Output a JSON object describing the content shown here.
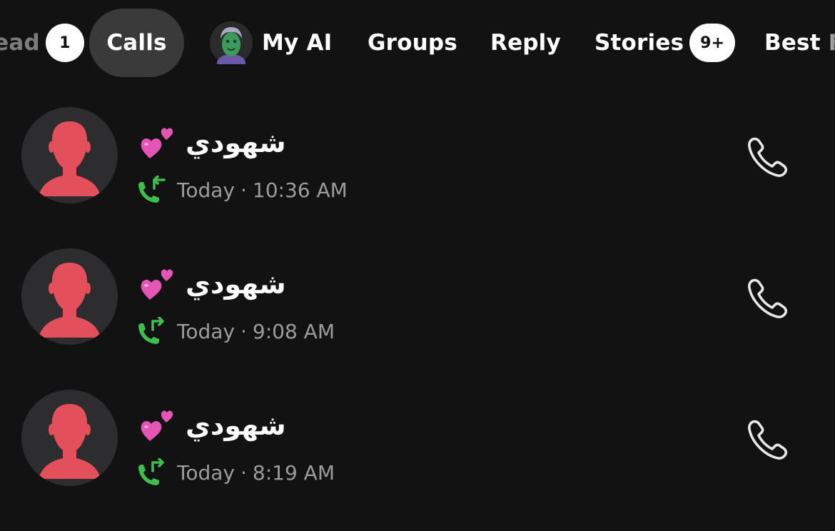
{
  "tabs": {
    "unread": {
      "label": "Unread",
      "badge": "1"
    },
    "calls": {
      "label": "Calls"
    },
    "myai": {
      "label": "My AI"
    },
    "groups": {
      "label": "Groups"
    },
    "reply": {
      "label": "Reply"
    },
    "stories": {
      "label": "Stories",
      "badge": "9+"
    },
    "best": {
      "label": "Best Fr"
    }
  },
  "colors": {
    "background": "#121212",
    "selected_tab": "#3a3a3a",
    "avatar_figure": "#e34f5a",
    "avatar_bg": "#2d2d2f",
    "call_arrow": "#3fbd4e",
    "meta_text": "#9c9c9c"
  },
  "calls": [
    {
      "name": "شهودي",
      "emoji": "two-hearts-icon",
      "direction": "incoming",
      "day": "Today",
      "separator": "·",
      "time": "10:36 AM",
      "action_icon": "phone-icon"
    },
    {
      "name": "شهودي",
      "emoji": "two-hearts-icon",
      "direction": "outgoing",
      "day": "Today",
      "separator": "·",
      "time": "9:08 AM",
      "action_icon": "phone-icon"
    },
    {
      "name": "شهودي",
      "emoji": "two-hearts-icon",
      "direction": "outgoing",
      "day": "Today",
      "separator": "·",
      "time": "8:19 AM",
      "action_icon": "phone-icon"
    }
  ]
}
